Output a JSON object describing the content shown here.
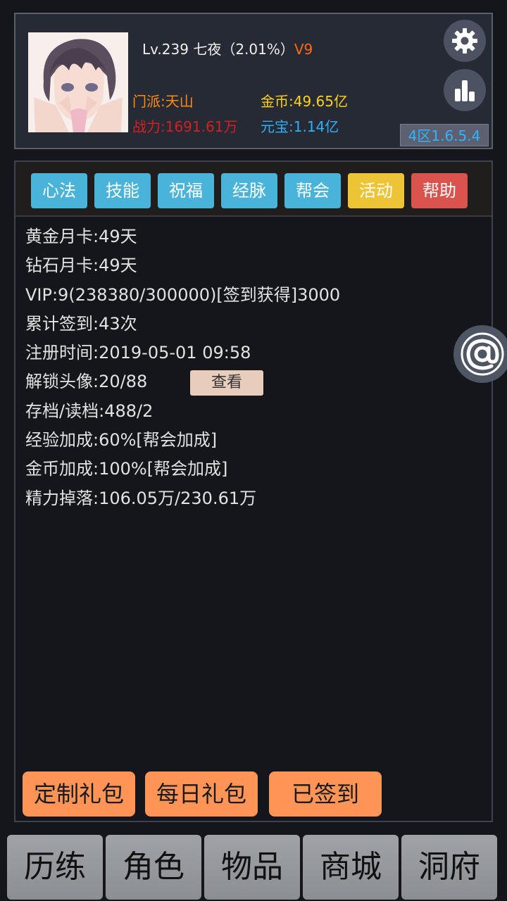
{
  "player": {
    "level_line": "Lv.239 七夜（2.01%）",
    "vip": "V9",
    "sect": "门派:天山",
    "power": "战力:1691.61万",
    "gold": "金币:49.65亿",
    "yuanbao": "元宝:1.14亿",
    "server": "4区1.6.5.4"
  },
  "icons": {
    "settings": "gear-icon",
    "ranking": "bar-chart-icon",
    "mention": "at-icon"
  },
  "tabs": [
    {
      "label": "心法",
      "color": "#4ab3d9"
    },
    {
      "label": "技能",
      "color": "#4ab3d9"
    },
    {
      "label": "祝福",
      "color": "#4ab3d9"
    },
    {
      "label": "经脉",
      "color": "#4ab3d9"
    },
    {
      "label": "帮会",
      "color": "#4ab3d9"
    },
    {
      "label": "活动",
      "color": "#eec437"
    },
    {
      "label": "帮助",
      "color": "#d9534f"
    }
  ],
  "info": {
    "gold_card": "黄金月卡:49天",
    "diamond_card": "钻石月卡:49天",
    "vip": "VIP:9(238380/300000)[签到获得]3000",
    "checkin": "累计签到:43次",
    "register": "注册时间:2019-05-01 09:58",
    "avatars": "解锁头像:20/88",
    "view_label": "查看",
    "saves": "存档/读档:488/2",
    "exp_bonus": "经验加成:60%[帮会加成]",
    "gold_bonus": "金币加成:100%[帮会加成]",
    "energy_drop": "精力掉落:106.05万/230.61万"
  },
  "gifts": {
    "custom": "定制礼包",
    "daily": "每日礼包",
    "signed": "已签到"
  },
  "nav": [
    "历练",
    "角色",
    "物品",
    "商城",
    "洞府"
  ]
}
